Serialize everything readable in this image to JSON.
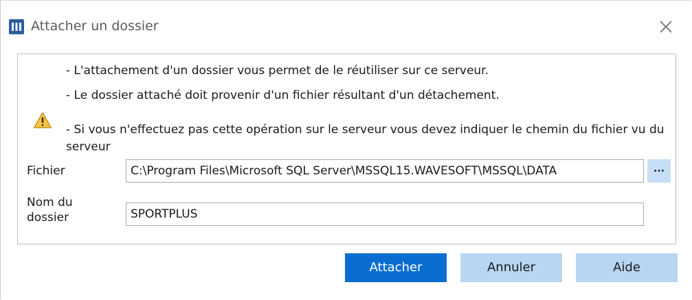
{
  "window": {
    "title": "Attacher un dossier"
  },
  "info": {
    "line1": "- L'attachement d'un dossier vous permet de le réutiliser sur ce serveur.",
    "line2": "- Le dossier attaché doit provenir d'un fichier résultant d'un détachement.",
    "line3": "- Si vous n'effectuez pas cette opération sur le serveur vous devez indiquer le chemin du fichier vu du serveur"
  },
  "form": {
    "file_label": "Fichier",
    "file_value": "C:\\Program Files\\Microsoft SQL Server\\MSSQL15.WAVESOFT\\MSSQL\\DATA",
    "browse_label": "...",
    "folder_name_label": "Nom du dossier",
    "folder_name_value": "SPORTPLUS"
  },
  "buttons": {
    "attach": "Attacher",
    "cancel": "Annuler",
    "help": "Aide"
  },
  "icons": {
    "app": "app-icon",
    "close": "close-icon",
    "warning": "warning-icon"
  },
  "colors": {
    "primary_button": "#0a6ed1",
    "secondary_button": "#b8d6f2",
    "browse_button": "#c7dff6",
    "warning_fill": "#f5c445"
  }
}
